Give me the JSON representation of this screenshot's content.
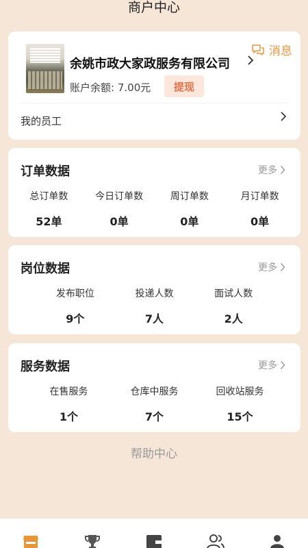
{
  "header": {
    "title": "商户中心"
  },
  "merchant": {
    "message_label": "消息",
    "company_name": "余姚市政大家政服务有限公司",
    "balance_label": "账户余额:",
    "balance_value": "7.00元",
    "withdraw_label": "提现",
    "staff_label": "我的员工"
  },
  "orders": {
    "title": "订单数据",
    "more_label": "更多",
    "stats": [
      {
        "label": "总订单数",
        "value": "52单"
      },
      {
        "label": "今日订单数",
        "value": "0单"
      },
      {
        "label": "周订单数",
        "value": "0单"
      },
      {
        "label": "月订单数",
        "value": "0单"
      }
    ]
  },
  "jobs": {
    "title": "岗位数据",
    "more_label": "更多",
    "stats": [
      {
        "label": "发布职位",
        "value": "9个"
      },
      {
        "label": "投递人数",
        "value": "7人"
      },
      {
        "label": "面试人数",
        "value": "2人"
      }
    ]
  },
  "services": {
    "title": "服务数据",
    "more_label": "更多",
    "stats": [
      {
        "label": "在售服务",
        "value": "1个"
      },
      {
        "label": "仓库中服务",
        "value": "7个"
      },
      {
        "label": "回收站服务",
        "value": "15个"
      }
    ]
  },
  "help_label": "帮助中心",
  "tabbar": {
    "tabs": [
      {
        "icon": "store-icon",
        "active": true
      },
      {
        "icon": "trophy-icon",
        "active": false
      },
      {
        "icon": "wallet-icon",
        "active": false
      },
      {
        "icon": "users-icon",
        "active": false
      },
      {
        "icon": "person-icon",
        "active": false
      }
    ]
  },
  "colors": {
    "background": "#f5e6d8",
    "accent": "#e8963c",
    "withdraw_bg": "#fde6dc",
    "withdraw_text": "#e0744a"
  }
}
